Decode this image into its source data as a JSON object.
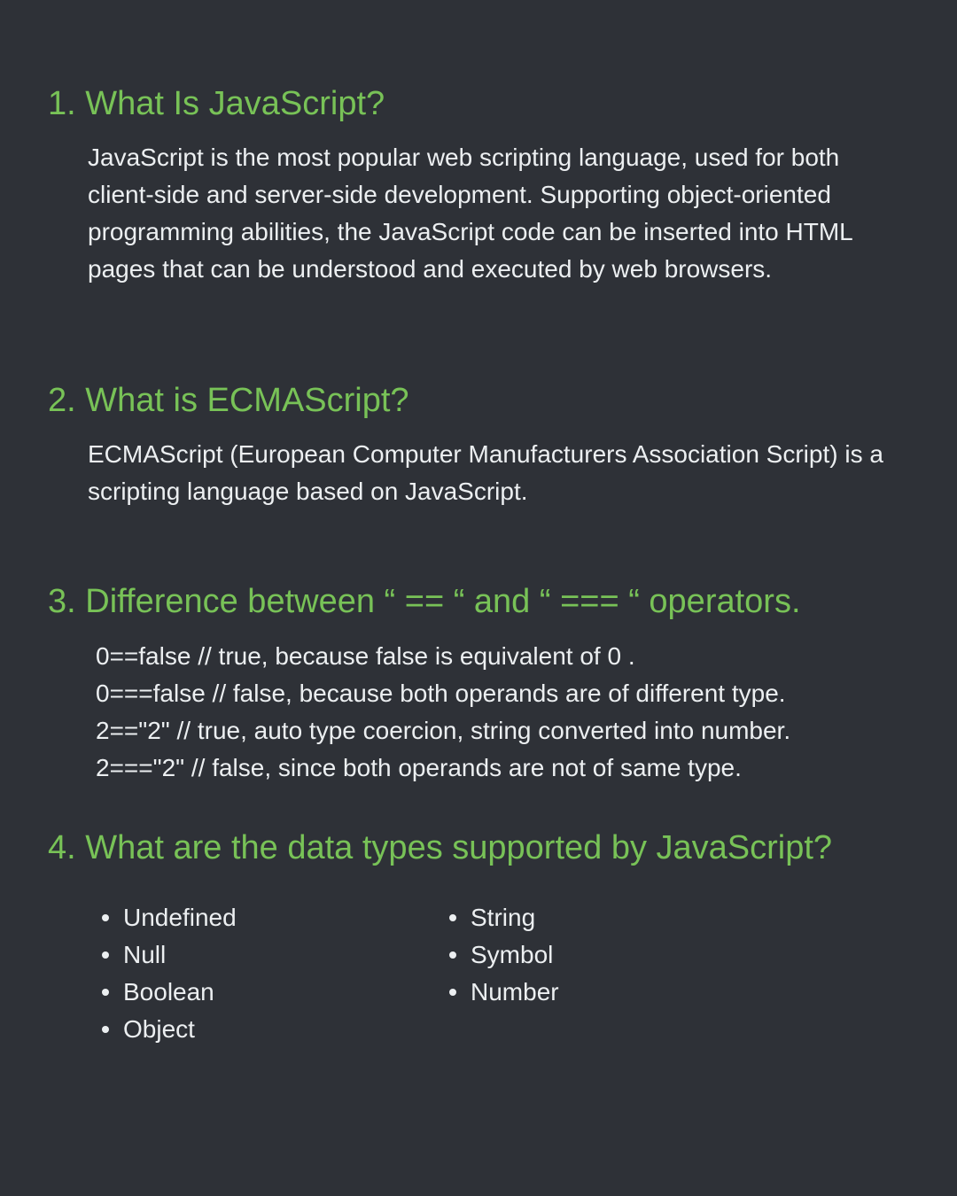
{
  "sections": [
    {
      "heading": "1. What Is JavaScript?",
      "body": "JavaScript is the most popular web scripting language, used for both client-side and server-side development. Supporting object-oriented programming abilities, the JavaScript code can be inserted into HTML pages that can be understood and executed by web browsers."
    },
    {
      "heading": "2. What is ECMAScript?",
      "body": "ECMAScript (European Computer Manufacturers Association Script) is a scripting language based on JavaScript."
    },
    {
      "heading": "3. Difference between “ == “ and “ === “ operators.",
      "lines": [
        "0==false // true, because false is equivalent of 0 .",
        "0===false // false, because both operands are of different type.",
        "2==\"2\" // true, auto type coercion, string converted into number.",
        "2===\"2\" // false, since both operands are not of same type."
      ]
    },
    {
      "heading": "4. What are the data types supported by JavaScript?",
      "types_left": [
        "Undefined",
        "Null",
        "Boolean",
        "Object"
      ],
      "types_right": [
        "String",
        "Symbol",
        "Number"
      ]
    }
  ],
  "colors": {
    "background": "#2e3137",
    "heading": "#78c257",
    "text": "#eceff1"
  }
}
